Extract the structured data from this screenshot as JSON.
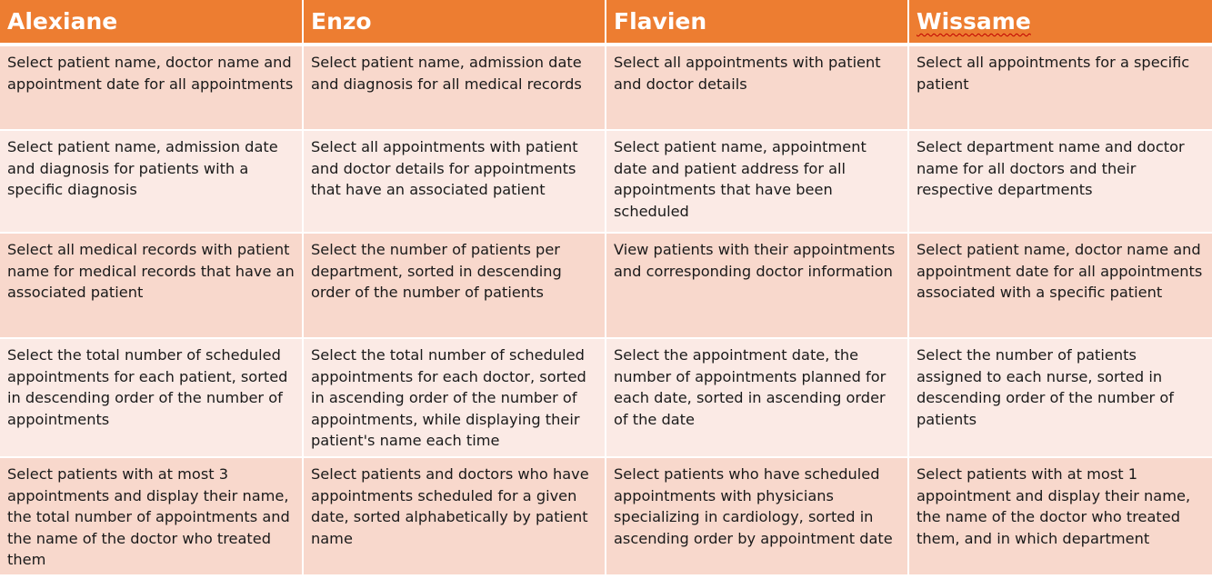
{
  "headers": [
    "Alexiane",
    "Enzo",
    "Flavien",
    "Wissame"
  ],
  "rows": [
    [
      "Select patient name, doctor name and appointment date for all appointments",
      "Select patient name, admission date and diagnosis for all medical records",
      "Select all appointments with patient and doctor details",
      "Select all appointments for a specific patient"
    ],
    [
      "Select patient name, admission date and diagnosis for patients with a specific diagnosis",
      "Select all appointments with patient and doctor details for appointments that have an associated patient",
      "Select patient name, appointment date and patient address for all appointments that have been scheduled",
      "Select department name and doctor name for all doctors and their respective departments"
    ],
    [
      "Select all medical records with patient name for medical records that have an associated patient",
      "Select the number of patients per department, sorted in descending order of the number of patients",
      "View patients with their appointments and corresponding doctor information",
      "Select patient name, doctor name and appointment date for all appointments associated with a specific patient"
    ],
    [
      "Select the total number of scheduled appointments for each patient, sorted in descending order of the number of appointments",
      "Select the total number of scheduled appointments for each doctor, sorted in ascending order of the number of appointments, while displaying their patient's name each time",
      "Select the appointment date, the number of appointments planned for each date, sorted in ascending order of the date",
      "Select the number of patients assigned to each nurse, sorted in descending order of the number of patients"
    ],
    [
      "Select patients with at most 3 appointments and display their name, the total number of appointments and the name of the doctor who treated them",
      "Select patients and doctors who have appointments scheduled for a given date, sorted alphabetically by patient name",
      "Select patients who have scheduled appointments with physicians specializing in cardiology, sorted in ascending order by appointment date",
      "Select patients with at most 1 appointment and display their name, the name of the doctor who treated them, and in which department"
    ]
  ],
  "colors": {
    "header_bg": "#ED7D31",
    "header_text": "#FFFFFF",
    "row_odd_bg": "#F8D8CC",
    "row_even_bg": "#FBEAE5"
  }
}
